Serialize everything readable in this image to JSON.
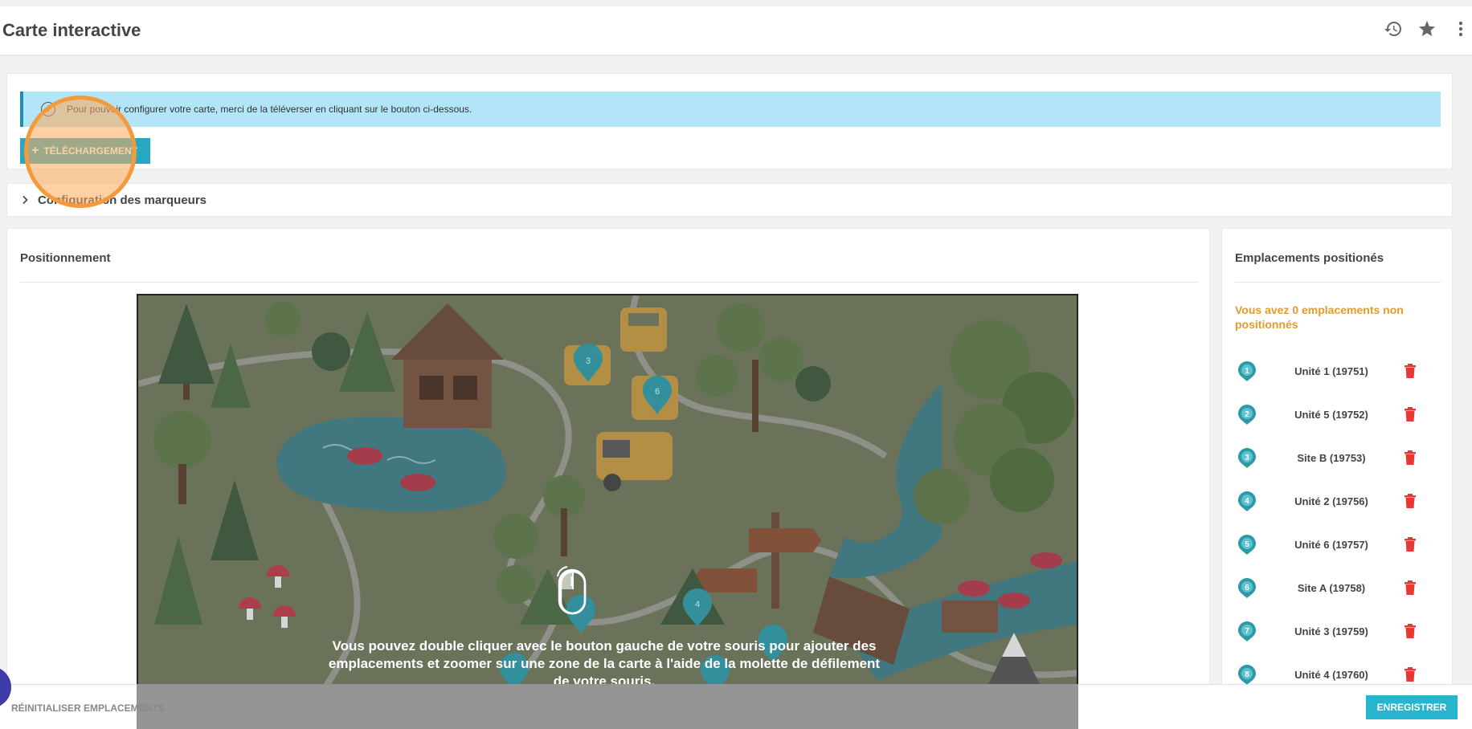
{
  "header": {
    "title": "Carte interactive"
  },
  "alert": {
    "icon": "info-icon",
    "text": "Pour pouvoir configurer votre carte, merci de la téléverser en cliquant sur le bouton ci-dessous."
  },
  "upload": {
    "label": "TÉLÉCHARGEMENT"
  },
  "markers_config": {
    "label": "Configuration des marqueurs"
  },
  "positioning": {
    "title": "Positionnement",
    "instruction": "Vous pouvez double cliquer avec le bouton gauche de votre souris pour ajouter des emplacements et zoomer sur une zone de la carte à l'aide de la molette de défilement de votre souris."
  },
  "locations": {
    "title": "Emplacements positionés",
    "unpositioned": "Vous avez 0 emplacements non positionnés",
    "items": [
      {
        "number": "1",
        "name": "Unité 1 (19751)"
      },
      {
        "number": "2",
        "name": "Unité 5 (19752)"
      },
      {
        "number": "3",
        "name": "Site B (19753)"
      },
      {
        "number": "4",
        "name": "Unité 2 (19756)"
      },
      {
        "number": "5",
        "name": "Unité 6 (19757)"
      },
      {
        "number": "6",
        "name": "Site A (19758)"
      },
      {
        "number": "7",
        "name": "Unité 3 (19759)"
      },
      {
        "number": "8",
        "name": "Unité 4 (19760)"
      }
    ]
  },
  "map_markers": [
    "3",
    "6",
    "4"
  ],
  "footer": {
    "reset_label": "RÉINITIALISER EMPLACEMENTS",
    "save_label": "ENREGISTRER"
  },
  "colors": {
    "accent": "#26a8c4",
    "warning": "#e59a30",
    "delete": "#e53935",
    "alert_bg": "#b3e5f9"
  }
}
